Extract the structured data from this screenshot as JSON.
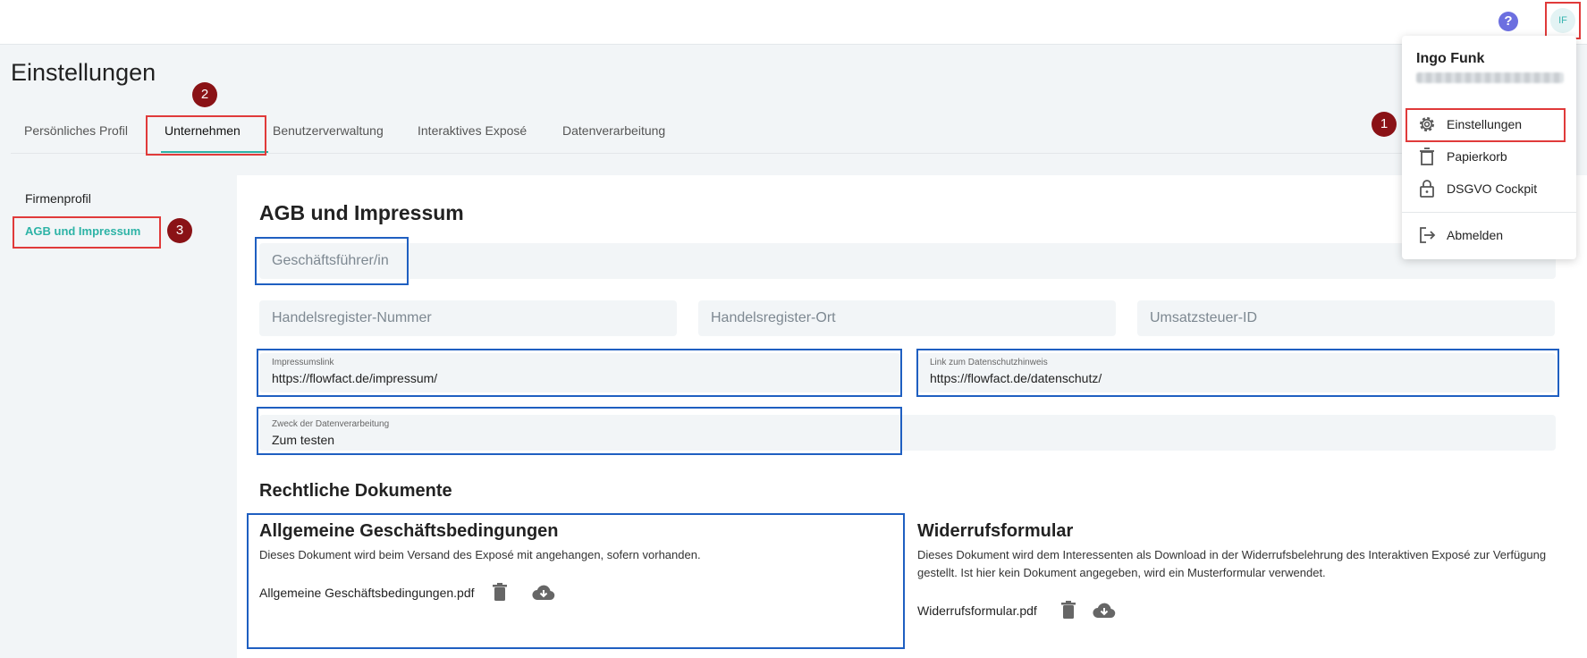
{
  "header": {
    "help_icon": "question-circle-icon",
    "avatar_initials": "IF"
  },
  "page": {
    "title": "Einstellungen"
  },
  "tabs": [
    {
      "label": "Persönliches Profil"
    },
    {
      "label": "Unternehmen"
    },
    {
      "label": "Benutzerverwaltung"
    },
    {
      "label": "Interaktives Exposé"
    },
    {
      "label": "Datenverarbeitung"
    }
  ],
  "sidebar": {
    "items": [
      {
        "label": "Firmenprofil"
      },
      {
        "label": "AGB und Impressum"
      }
    ]
  },
  "badges": {
    "one": "1",
    "two": "2",
    "three": "3"
  },
  "main": {
    "section_title": "AGB und Impressum",
    "fields": {
      "geschaeftsfuehrer_placeholder": "Geschäftsführer/in",
      "hr_nummer_placeholder": "Handelsregister-Nummer",
      "hr_ort_placeholder": "Handelsregister-Ort",
      "ust_placeholder": "Umsatzsteuer-ID",
      "impressum_label": "Impressumslink",
      "impressum_value": "https://flowfact.de/impressum/",
      "datenschutz_label": "Link zum Datenschutzhinweis",
      "datenschutz_value": "https://flowfact.de/datenschutz/",
      "zweck_label": "Zweck der Datenverarbeitung",
      "zweck_value": "Zum testen"
    },
    "legal_docs_title": "Rechtliche Dokumente",
    "agb": {
      "title": "Allgemeine Geschäftsbedingungen",
      "description": "Dieses Dokument wird beim Versand des Exposé mit angehangen, sofern vorhanden.",
      "filename": "Allgemeine Geschäftsbedingungen.pdf"
    },
    "widerruf": {
      "title": "Widerrufsformular",
      "description": "Dieses Dokument wird dem Interessenten als Download in der Widerrufsbelehrung des Interaktiven Exposé zur Verfügung gestellt. Ist hier kein Dokument angegeben, wird ein Musterformular verwendet.",
      "filename": "Widerrufsformular.pdf"
    }
  },
  "user_menu": {
    "name": "Ingo Funk",
    "items": [
      {
        "label": "Einstellungen",
        "icon": "gear-icon"
      },
      {
        "label": "Papierkorb",
        "icon": "trash-icon"
      },
      {
        "label": "DSGVO Cockpit",
        "icon": "lock-icon"
      },
      {
        "label": "Abmelden",
        "icon": "logout-icon"
      }
    ]
  },
  "colors": {
    "accent": "#2db3a6",
    "annotation_red": "#e03a3a",
    "annotation_blue": "#1f5fc1",
    "badge": "#8a1216"
  }
}
